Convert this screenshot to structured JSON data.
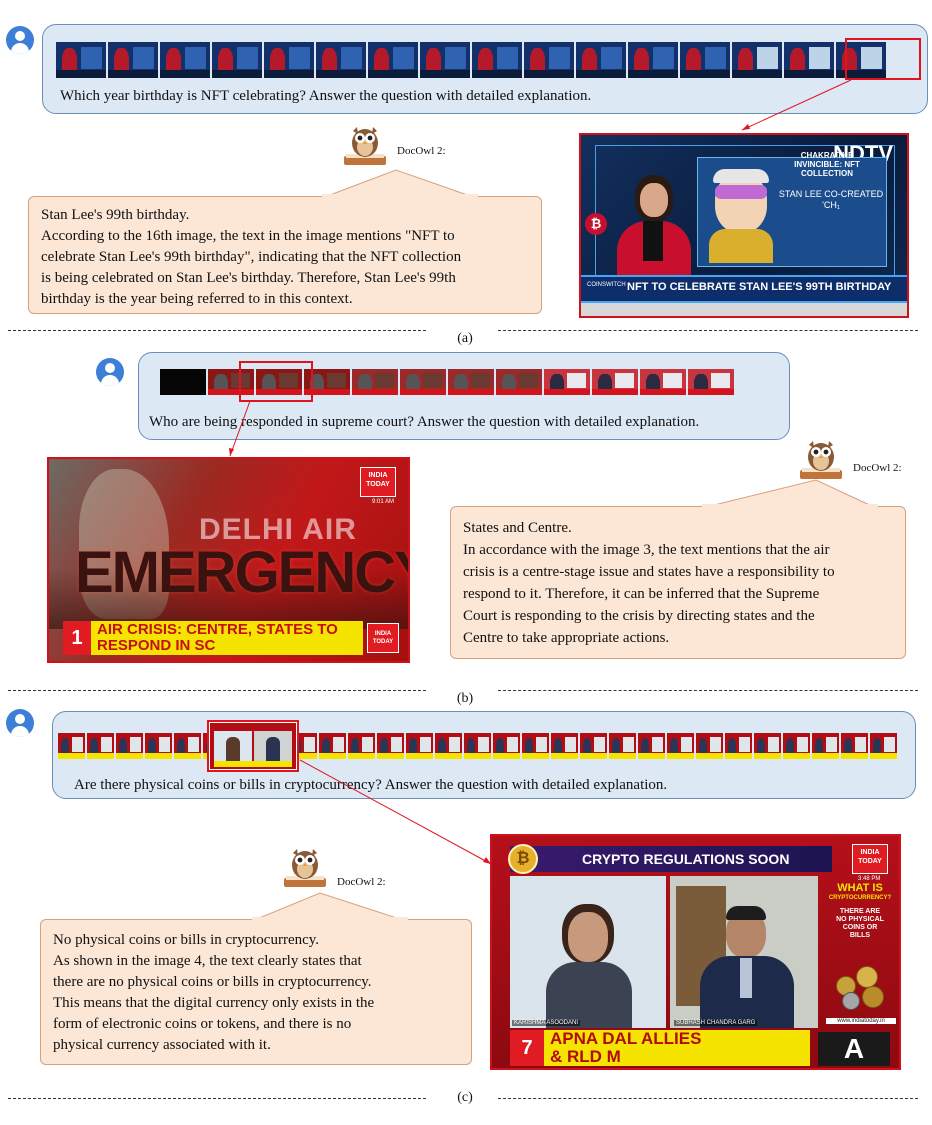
{
  "owl_label": "DocOwl 2:",
  "example_a": {
    "question": "Which year birthday is NFT celebrating? Answer the question with detailed explanation.",
    "answer_lines": [
      "Stan Lee's 99th birthday.",
      "According to the 16th image, the text in the image mentions \"NFT to",
      "celebrate Stan Lee's 99th birthday\", indicating that the NFT collection",
      "is being celebrated on Stan Lee's birthday. Therefore, Stan Lee's 99th",
      "birthday is the year being referred to in this context."
    ],
    "frame": {
      "logo": "NDTV",
      "title_1": "CHAKRA THE",
      "title_2": "INVINCIBLE: NFT",
      "title_3": "COLLECTION",
      "side_text_1": "STAN LEE CO-CREATED",
      "side_text_2": "'CH₁",
      "ticker": "NFT TO CELEBRATE STAN LEE'S 99TH BIRTHDAY",
      "brand": "COINSWITCH"
    },
    "caption": "(a)"
  },
  "example_b": {
    "question": "Who are being responded in supreme court?  Answer the question with detailed explanation.",
    "answer_lines": [
      "States and Centre.",
      " In accordance with the image 3, the text mentions that the air",
      "crisis is a centre-stage issue and states have a responsibility to",
      "respond to it. Therefore, it can be inferred that the Supreme",
      "Court is responding to the crisis by directing states and the",
      "Centre to take appropriate actions."
    ],
    "frame": {
      "logo_1": "INDIA",
      "logo_2": "TODAY",
      "time": "9:01 AM",
      "headline_small": "DELHI AIR",
      "headline_big": "EMERGENCY",
      "number": "1",
      "ticker_1": "AIR CRISIS: CENTRE, STATES TO",
      "ticker_2": "RESPOND IN SC"
    },
    "caption": "(b)"
  },
  "example_c": {
    "question": "Are there physical coins or bills in cryptocurrency? Answer the question with detailed explanation.",
    "answer_lines": [
      "No physical coins or bills in cryptocurrency.",
      "As shown in the image 4, the text clearly states that",
      "there are no physical coins or bills in cryptocurrency.",
      "This means that the digital currency only exists in the",
      "form of electronic coins or tokens, and there is no",
      "physical currency associated with it."
    ],
    "frame": {
      "banner": "CRYPTO REGULATIONS SOON",
      "logo_1": "INDIA",
      "logo_2": "TODAY",
      "time": "3:48 PM",
      "side_title_1": "WHAT IS",
      "side_title_2": "CRYPTOCURRENCY?",
      "side_text_1": "THERE ARE",
      "side_text_2": "NO PHYSICAL",
      "side_text_3": "COINS OR",
      "side_text_4": "BILLS",
      "name_left": "KARISHMA ASOODANI",
      "name_right": "SUBHASH CHANDRA GARG",
      "url": "www.indiatoday.in",
      "number": "7",
      "ticker_1": "APNA DAL ALLIES",
      "ticker_2": "& RLD M"
    },
    "caption": "(c)"
  },
  "colors": {
    "question_bg": "#dde8f5",
    "answer_bg": "#fce6d6",
    "highlight": "#e0141e",
    "avatar": "#3d7fd6"
  }
}
